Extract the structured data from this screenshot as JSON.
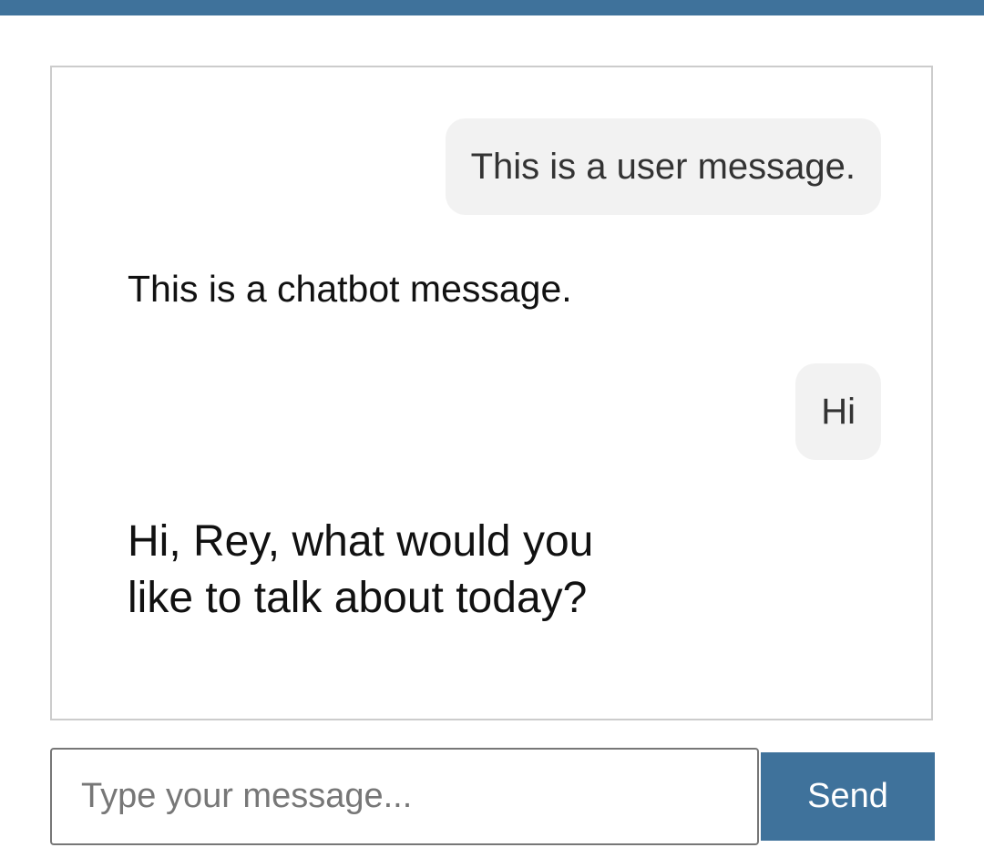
{
  "colors": {
    "accent": "#3f729b",
    "user_bubble": "#f2f2f2",
    "chat_border": "#cccccc"
  },
  "chat": {
    "messages": [
      {
        "sender": "user",
        "text": "This is a user message."
      },
      {
        "sender": "bot",
        "text": "This is a chatbot message."
      },
      {
        "sender": "user",
        "text": "Hi"
      },
      {
        "sender": "bot",
        "text": "Hi, Rey, what would you like to talk about today?"
      }
    ]
  },
  "composer": {
    "placeholder": "Type your message...",
    "value": "",
    "send_label": "Send"
  }
}
